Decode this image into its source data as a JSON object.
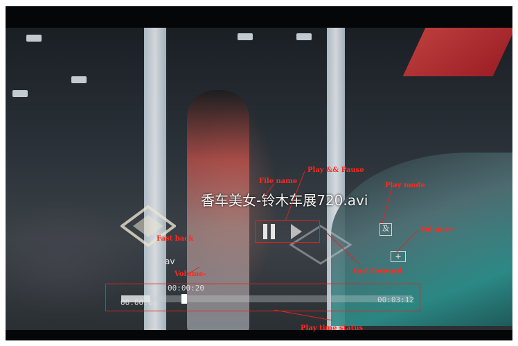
{
  "player": {
    "file_name": "香车美女-铃木车展720.avi",
    "time_current": "00:00:20",
    "time_start": "00:00:00",
    "time_total": "00:03:12",
    "progress": 0.1,
    "volume_minus_label": "av",
    "volume_plus_label": "+",
    "play_mode_label": "及"
  },
  "annotations": {
    "play_pause": "Play && Pause",
    "file_name": "File name",
    "play_mode": "Play mode",
    "fast_back": "Fast back",
    "volume_plus": "Volume+",
    "volume_minus": "Volume-",
    "fast_forward": "Fast forward",
    "play_time_status": "Play time status"
  },
  "colors": {
    "annotation": "#e0251d",
    "overlay_text": "#f4f4f4"
  },
  "icons": {
    "play_pause": "pause-play-icon",
    "fast_back": "fast-back-icon",
    "fast_forward": "fast-forward-icon",
    "play_mode": "play-mode-icon"
  }
}
